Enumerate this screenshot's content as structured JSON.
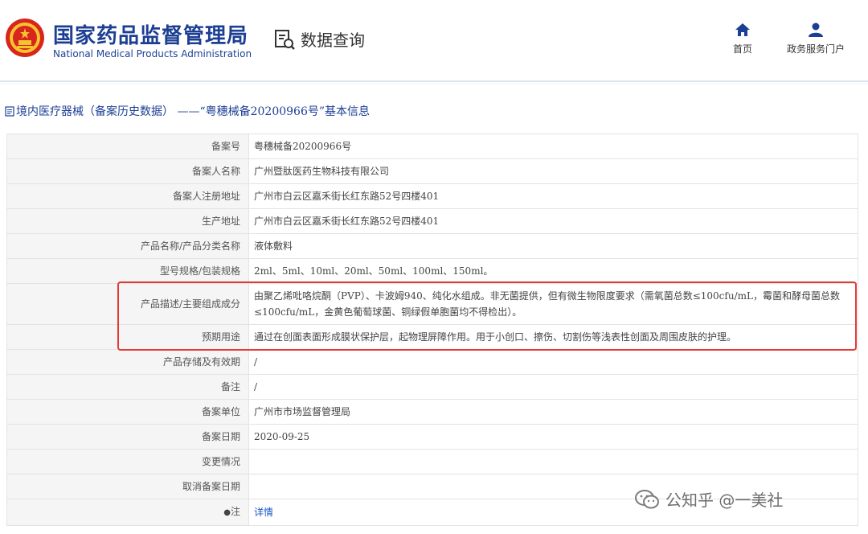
{
  "header": {
    "agency_cn": "国家药品监督管理局",
    "agency_en": "National Medical Products Administration",
    "query_label": "数据查询",
    "nav": [
      {
        "label": "首页",
        "icon": "home-icon"
      },
      {
        "label": "政务服务门户",
        "icon": "user-icon"
      }
    ]
  },
  "breadcrumb": "境内医疗器械（备案历史数据） ——“粤穗械备20200966号”基本信息",
  "record": {
    "rows": [
      {
        "label": "备案号",
        "value": "粤穗械备20200966号"
      },
      {
        "label": "备案人名称",
        "value": "广州暨肽医药生物科技有限公司"
      },
      {
        "label": "备案人注册地址",
        "value": "广州市白云区嘉禾街长红东路52号四楼401"
      },
      {
        "label": "生产地址",
        "value": "广州市白云区嘉禾街长红东路52号四楼401"
      },
      {
        "label": "产品名称/产品分类名称",
        "value": "液体敷料"
      },
      {
        "label": "型号规格/包装规格",
        "value": "2ml、5ml、10ml、20ml、50ml、100ml、150ml。"
      },
      {
        "label": "产品描述/主要组成成分",
        "value": "由聚乙烯吡咯烷酮（PVP）、卡波姆940、纯化水组成。非无菌提供，但有微生物限度要求（需氧菌总数≤100cfu/mL，霉菌和酵母菌总数≤100cfu/mL，金黄色葡萄球菌、铜绿假单胞菌均不得检出）。"
      },
      {
        "label": "预期用途",
        "value": "通过在创面表面形成膜状保护层，起物理屏障作用。用于小创口、擦伤、切割伤等浅表性创面及周围皮肤的护理。"
      },
      {
        "label": "产品存储及有效期",
        "value": "/"
      },
      {
        "label": "备注",
        "value": "/"
      },
      {
        "label": "备案单位",
        "value": "广州市市场监督管理局"
      },
      {
        "label": "备案日期",
        "value": "2020-09-25"
      },
      {
        "label": "变更情况",
        "value": ""
      },
      {
        "label": "取消备案日期",
        "value": ""
      }
    ],
    "note_label": "注",
    "note_link": "详情"
  },
  "watermark": "公知乎 @一美社",
  "colors": {
    "brand": "#1c3f94",
    "highlight": "#e53935",
    "link": "#1a57c6"
  }
}
